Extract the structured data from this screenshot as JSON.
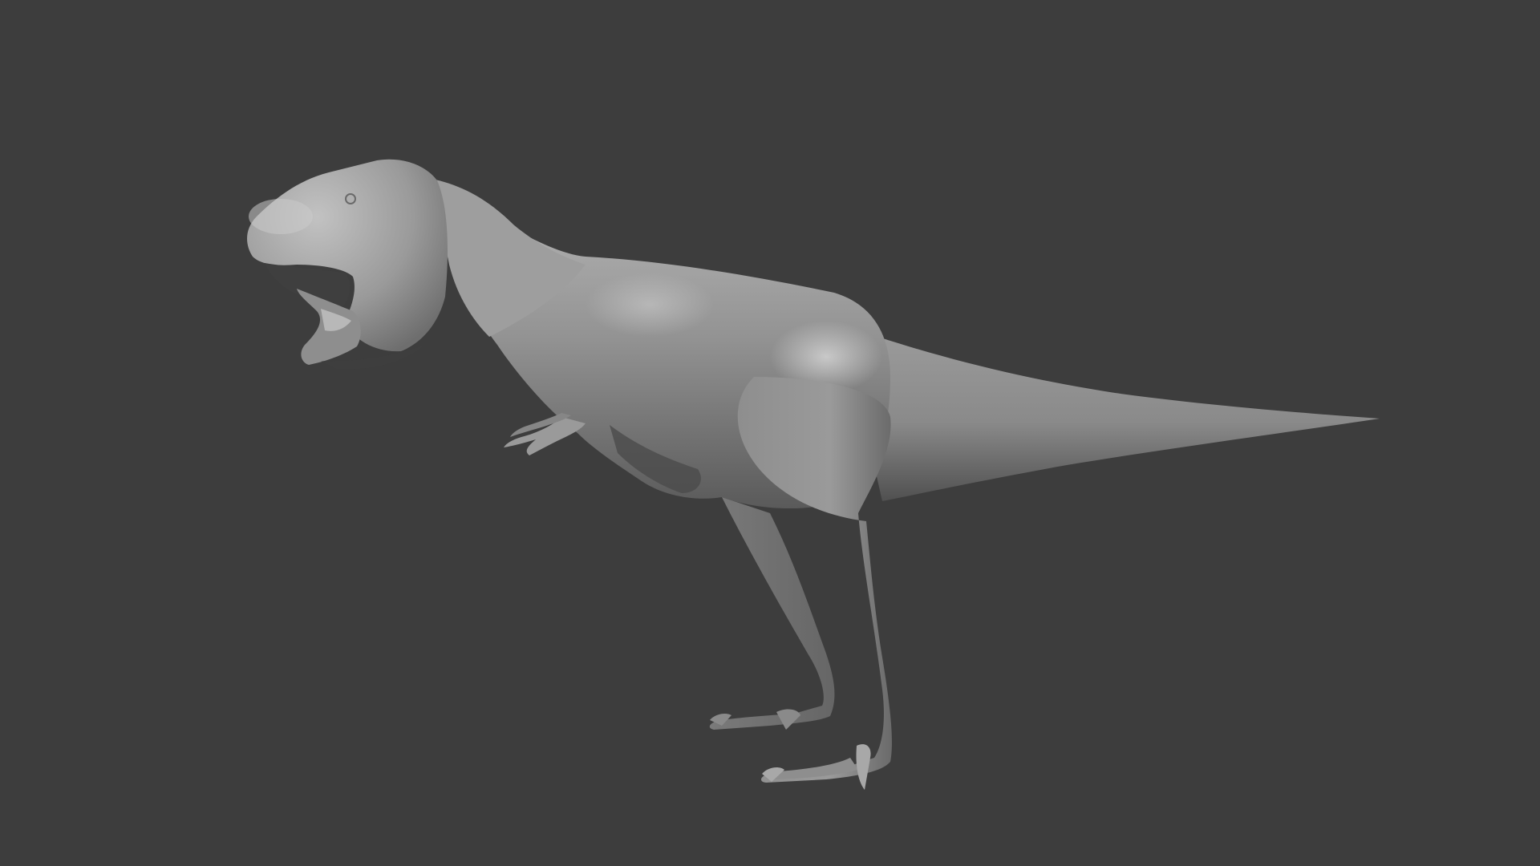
{
  "render": {
    "subject": "dinosaur-model",
    "shading": "smooth-grey-clay",
    "background_color": "#3d3d3d",
    "model_color": "#8f8f8f",
    "highlight_color": "#bdbdbd",
    "shadow_color": "#4a4a4a",
    "texts": []
  }
}
